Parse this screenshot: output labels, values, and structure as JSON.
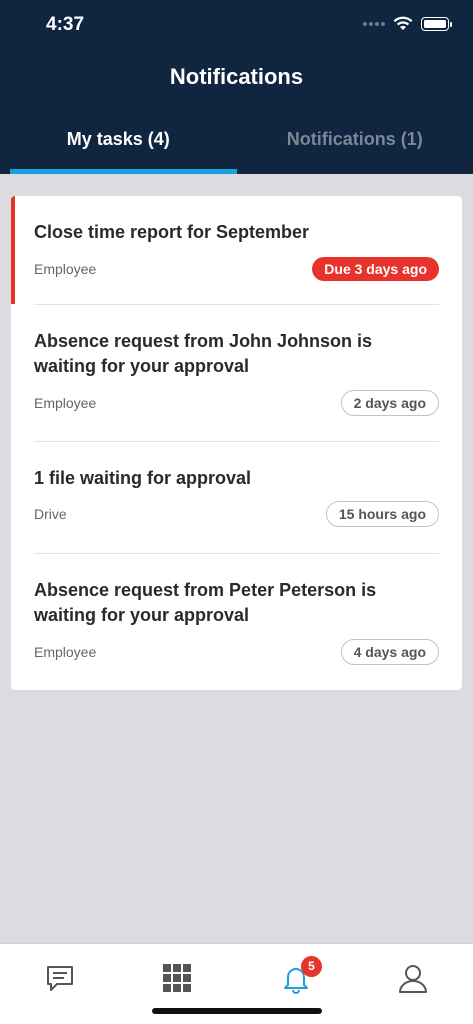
{
  "status_bar": {
    "time": "4:37"
  },
  "header": {
    "title": "Notifications",
    "tabs": [
      {
        "label": "My tasks (4)",
        "active": true
      },
      {
        "label": "Notifications (1)",
        "active": false
      }
    ]
  },
  "tasks": [
    {
      "title": "Close time report for September",
      "source": "Employee",
      "badge": "Due 3 days ago",
      "overdue": true
    },
    {
      "title": "Absence request from John Johnson is waiting for your approval",
      "source": "Employee",
      "badge": "2 days ago",
      "overdue": false
    },
    {
      "title": "1 file waiting for approval",
      "source": "Drive",
      "badge": "15 hours ago",
      "overdue": false
    },
    {
      "title": "Absence request from Peter Peterson is waiting for your approval",
      "source": "Employee",
      "badge": "4 days ago",
      "overdue": false
    }
  ],
  "tab_bar": {
    "items": [
      {
        "icon": "chat-icon"
      },
      {
        "icon": "grid-icon"
      },
      {
        "icon": "bell-icon",
        "badge_count": "5",
        "active": true
      },
      {
        "icon": "profile-icon"
      }
    ]
  },
  "colors": {
    "header_bg": "#0f2540",
    "accent": "#1aa0e0",
    "alert": "#e8322c"
  }
}
